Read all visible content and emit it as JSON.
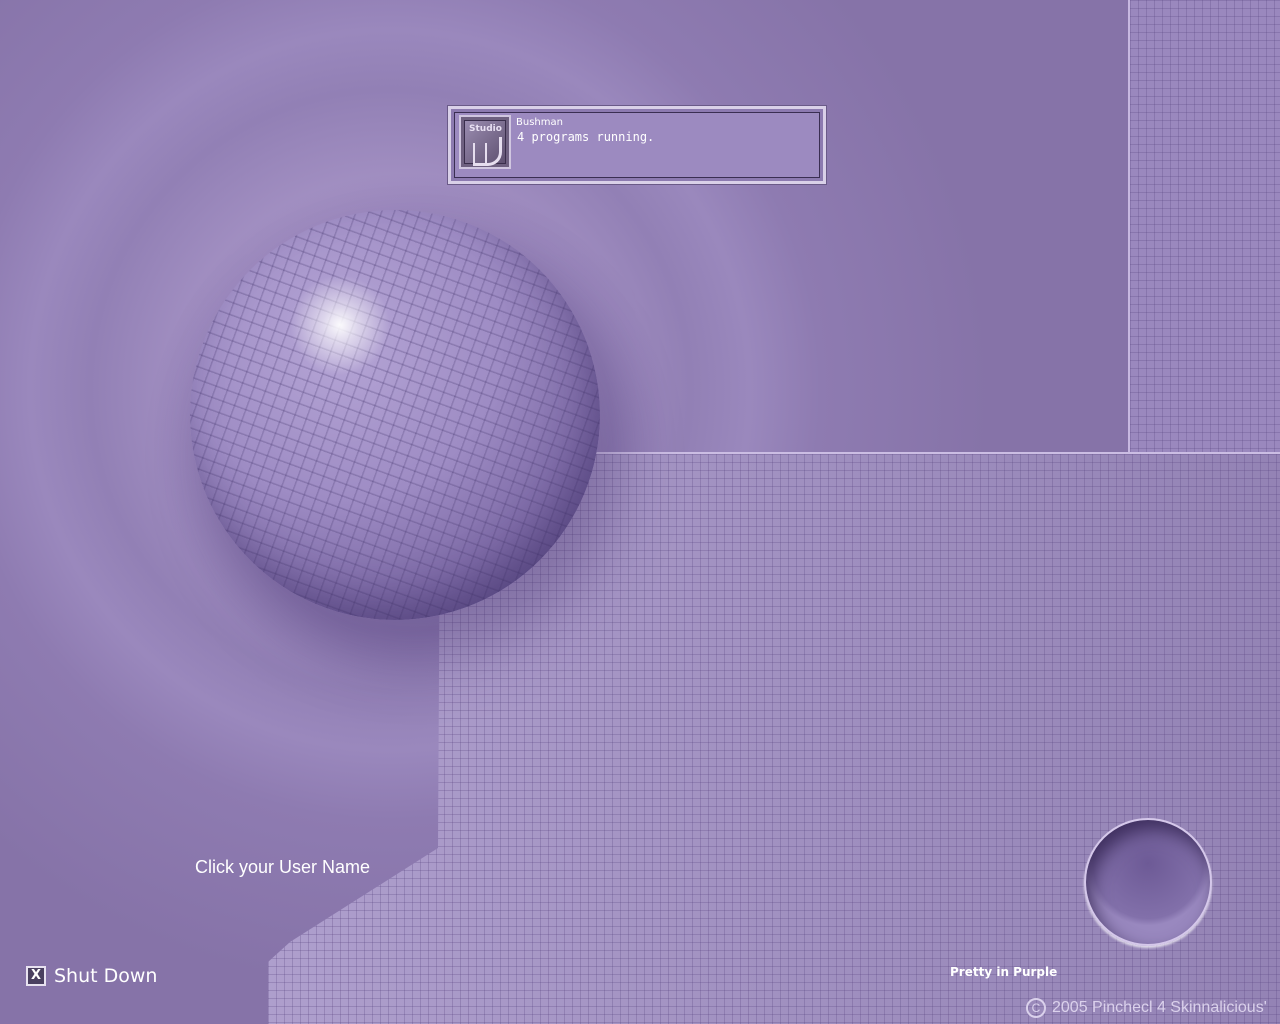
{
  "login": {
    "prompt": "Click your User Name",
    "users": [
      {
        "name": "Bushman",
        "status": "4 programs running.",
        "avatar_text": "Studio"
      }
    ]
  },
  "shutdown": {
    "label": "Shut Down",
    "icon": "x-icon",
    "icon_glyph": "X"
  },
  "branding": {
    "theme_name": "Pretty in Purple",
    "copyright": "2005 Pinchecl 4 Skinnalicious'",
    "copyright_symbol": "C"
  },
  "colors": {
    "background": "#8e7bb1",
    "panel": "#a08ec4",
    "text": "#ffffff"
  }
}
